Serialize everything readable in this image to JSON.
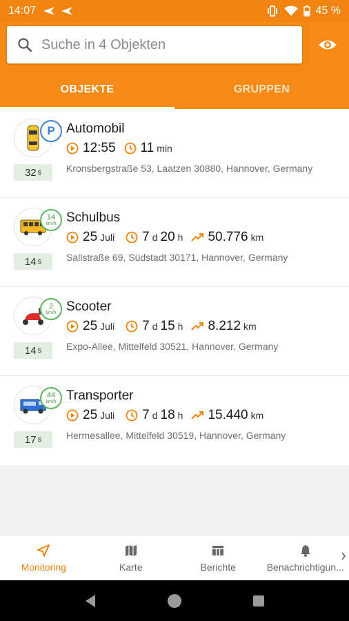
{
  "status_bar": {
    "time": "14:07",
    "battery": "45 %"
  },
  "search": {
    "placeholder": "Suche in 4 Objekten"
  },
  "tabs": [
    {
      "label": "OBJEKTE",
      "active": true
    },
    {
      "label": "GRUPPEN",
      "active": false
    }
  ],
  "objects": [
    {
      "name": "Automobil",
      "status": "P",
      "time": "12:55",
      "duration_value": "11",
      "duration_unit": "min",
      "address": "Kronsbergstraße 53, Laatzen 30880, Hannover, Germany",
      "age_value": "32",
      "age_unit": "s"
    },
    {
      "name": "Schulbus",
      "speed": "14",
      "speed_unit": "km/h",
      "date_day": "25",
      "date_month": "Juli",
      "dur_days": "7",
      "dur_d_unit": "d",
      "dur_hours": "20",
      "dur_h_unit": "h",
      "distance": "50.776",
      "distance_unit": "km",
      "address": "Sallstraße 69, Südstadt 30171, Hannover, Germany",
      "age_value": "14",
      "age_unit": "s"
    },
    {
      "name": "Scooter",
      "speed": "2",
      "speed_unit": "km/h",
      "date_day": "25",
      "date_month": "Juli",
      "dur_days": "7",
      "dur_d_unit": "d",
      "dur_hours": "15",
      "dur_h_unit": "h",
      "distance": "8.212",
      "distance_unit": "km",
      "address": "Expo-Allee, Mittelfeld 30521, Hannover, Germany",
      "age_value": "14",
      "age_unit": "s"
    },
    {
      "name": "Transporter",
      "speed": "44",
      "speed_unit": "km/h",
      "date_day": "25",
      "date_month": "Juli",
      "dur_days": "7",
      "dur_d_unit": "d",
      "dur_hours": "18",
      "dur_h_unit": "h",
      "distance": "15.440",
      "distance_unit": "km",
      "address": "Hermesallee, Mittelfeld 30519, Hannover, Germany",
      "age_value": "17",
      "age_unit": "s"
    }
  ],
  "bottom_nav": [
    {
      "label": "Monitoring",
      "icon": "navigation-arrow-icon",
      "active": true
    },
    {
      "label": "Karte",
      "icon": "map-icon",
      "active": false
    },
    {
      "label": "Berichte",
      "icon": "table-icon",
      "active": false
    },
    {
      "label": "Benachrichtigun...",
      "icon": "bell-icon",
      "active": false
    }
  ],
  "colors": {
    "brand": "#f58a14",
    "parking": "#3b82d6",
    "speed": "#5bb55c"
  }
}
